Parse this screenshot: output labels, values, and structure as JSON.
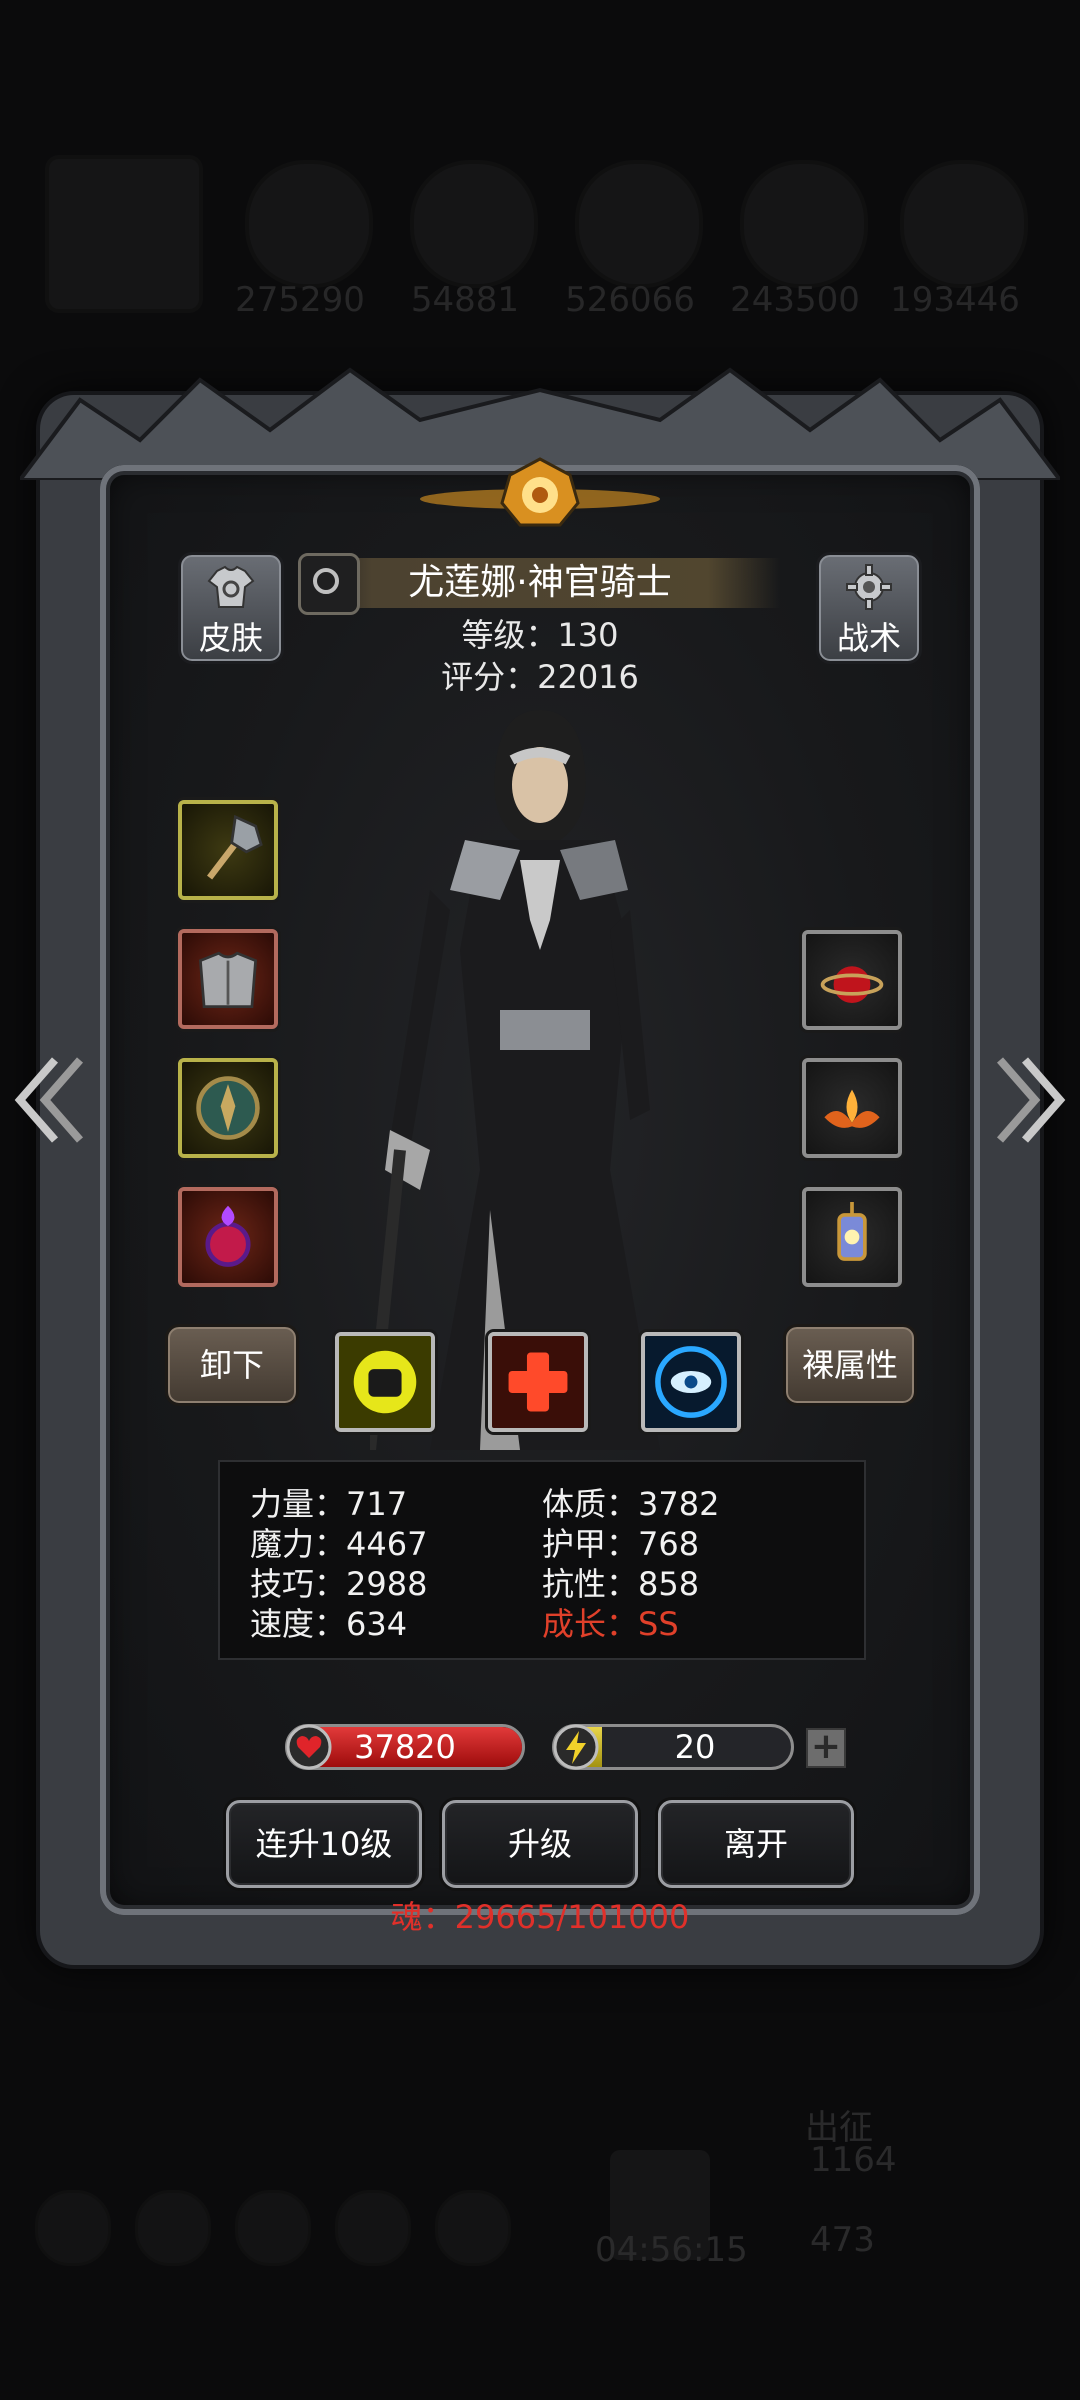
{
  "background": {
    "resources": [
      "275290",
      "54881",
      "526066",
      "243500",
      "193446"
    ],
    "timer": "04:56:15",
    "expedition": "出征",
    "count_a": "1164",
    "count_b": "473"
  },
  "hero": {
    "name": "尤莲娜·神官骑士",
    "level_text": "等级：130",
    "score_text": "评分：22016"
  },
  "buttons": {
    "skin": "皮肤",
    "tactics": "战术",
    "unequip": "卸下",
    "base_attrs": "裸属性",
    "level10": "连升10级",
    "levelup": "升级",
    "leave": "离开"
  },
  "equipment": {
    "left": [
      "mace-icon",
      "chest-armor-icon",
      "shield-icon",
      "red-amulet-icon"
    ],
    "right": [
      "ruby-relic-icon",
      "lotus-flame-icon",
      "lantern-icon"
    ]
  },
  "skills": [
    "fist-icon",
    "red-cross-icon",
    "blue-eye-icon"
  ],
  "stats": {
    "strength": "力量：717",
    "magic": "魔力：4467",
    "skill": "技巧：2988",
    "speed": "速度：634",
    "physique": "体质：3782",
    "armor": "护甲：768",
    "resist": "抗性：858",
    "growth": "成长：SS"
  },
  "bars": {
    "hp": "37820",
    "hp_fill": 1.0,
    "energy": "20",
    "energy_fill": 0.2,
    "hp_color": "#d42020",
    "energy_color": "#d6c52e"
  },
  "soul": "魂：29665/101000"
}
